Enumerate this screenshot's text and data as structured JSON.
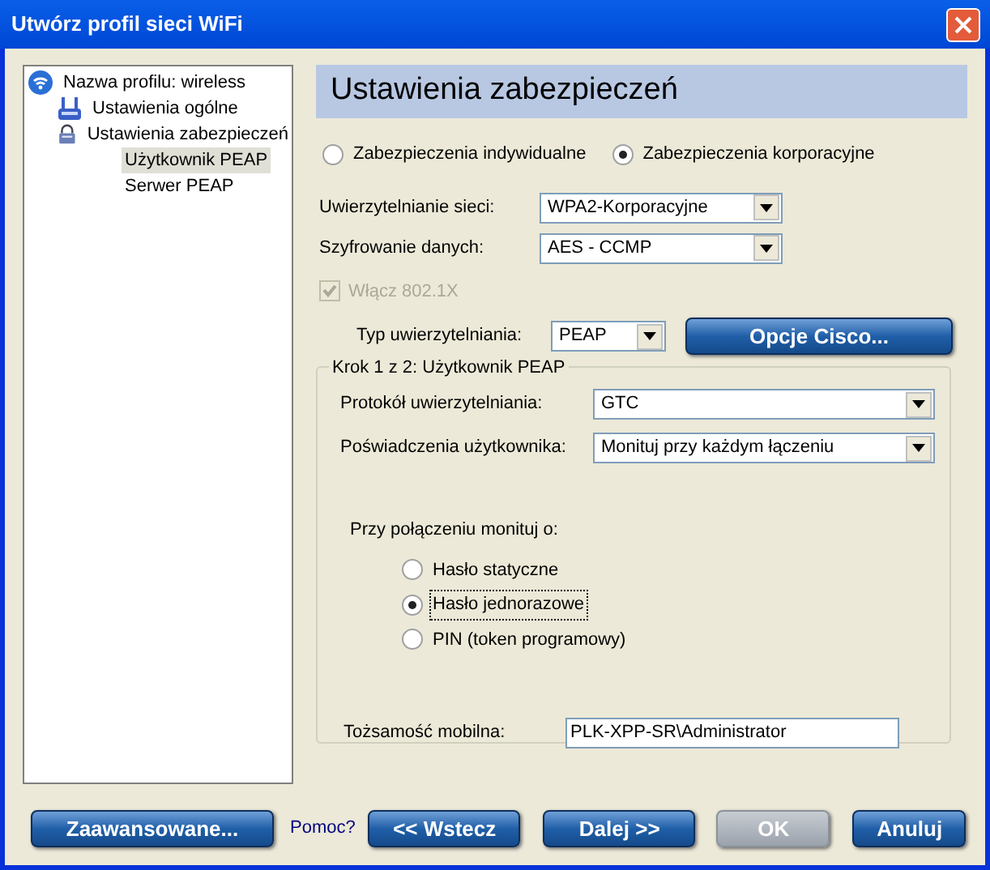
{
  "window": {
    "title": "Utwórz profil sieci WiFi"
  },
  "tree": [
    {
      "label": "Nazwa profilu: wireless",
      "kind": "profile",
      "selected": false,
      "children": [
        {
          "label": "Ustawienia ogólne",
          "kind": "general",
          "selected": false
        },
        {
          "label": "Ustawienia zabezpieczeń",
          "kind": "security",
          "selected": false,
          "children": [
            {
              "label": "Użytkownik PEAP",
              "selected": true
            },
            {
              "label": "Serwer PEAP",
              "selected": false
            }
          ]
        }
      ]
    }
  ],
  "header": "Ustawienia zabezpieczeń",
  "security_mode": [
    {
      "label": "Zabezpieczenia indywidualne",
      "selected": false
    },
    {
      "label": "Zabezpieczenia korporacyjne",
      "selected": true
    }
  ],
  "network_fields": [
    {
      "label": "Uwierzytelnianie sieci:",
      "value": "WPA2-Korporacyjne"
    },
    {
      "label": "Szyfrowanie danych:",
      "value": "AES - CCMP"
    }
  ],
  "enable_8021x": {
    "label": "Włącz 802.1X",
    "checked": true,
    "disabled": true
  },
  "auth_type": {
    "label": "Typ uwierzytelniania:",
    "value": "PEAP"
  },
  "cisco_button": "Opcje Cisco...",
  "step_group": {
    "title": "Krok 1 z 2: Użytkownik PEAP",
    "fields": [
      {
        "label": "Protokół uwierzytelniania:",
        "value": "GTC"
      },
      {
        "label": "Poświadczenia użytkownika:",
        "value": "Monituj przy każdym łączeniu"
      }
    ],
    "prompt_label": "Przy połączeniu monituj o:",
    "prompt_options": [
      {
        "label": "Hasło statyczne",
        "selected": false,
        "focused": false
      },
      {
        "label": "Hasło jednorazowe",
        "selected": true,
        "focused": true
      },
      {
        "label": "PIN (token programowy)",
        "selected": false,
        "focused": false
      }
    ],
    "identity": {
      "label": "Tożsamość mobilna:",
      "value": "PLK-XPP-SR\\Administrator"
    }
  },
  "footer": {
    "advanced": "Zaawansowane...",
    "help_link": "Pomoc?",
    "buttons": [
      {
        "label": "<< Wstecz",
        "disabled": false
      },
      {
        "label": "Dalej >>",
        "disabled": false
      },
      {
        "label": "OK",
        "disabled": true
      },
      {
        "label": "Anuluj",
        "disabled": false
      }
    ]
  }
}
